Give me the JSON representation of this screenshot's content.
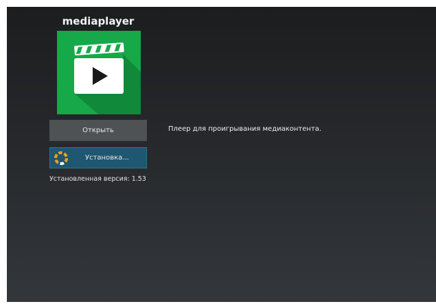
{
  "app": {
    "name": "mediaplayer",
    "icon": "clapperboard-play-icon",
    "icon_color": "#17a84a",
    "description": "Плеер для проигрывания медиаконтента.",
    "installed_version": "Установленная версия: 1.53"
  },
  "actions": {
    "open_label": "Открыть",
    "install_label": "Установка...",
    "install_icon": "loading-spinner-icon"
  },
  "colors": {
    "open_button": "#4f5255",
    "install_button": "#1f5671",
    "spinner": "#f0a020"
  }
}
